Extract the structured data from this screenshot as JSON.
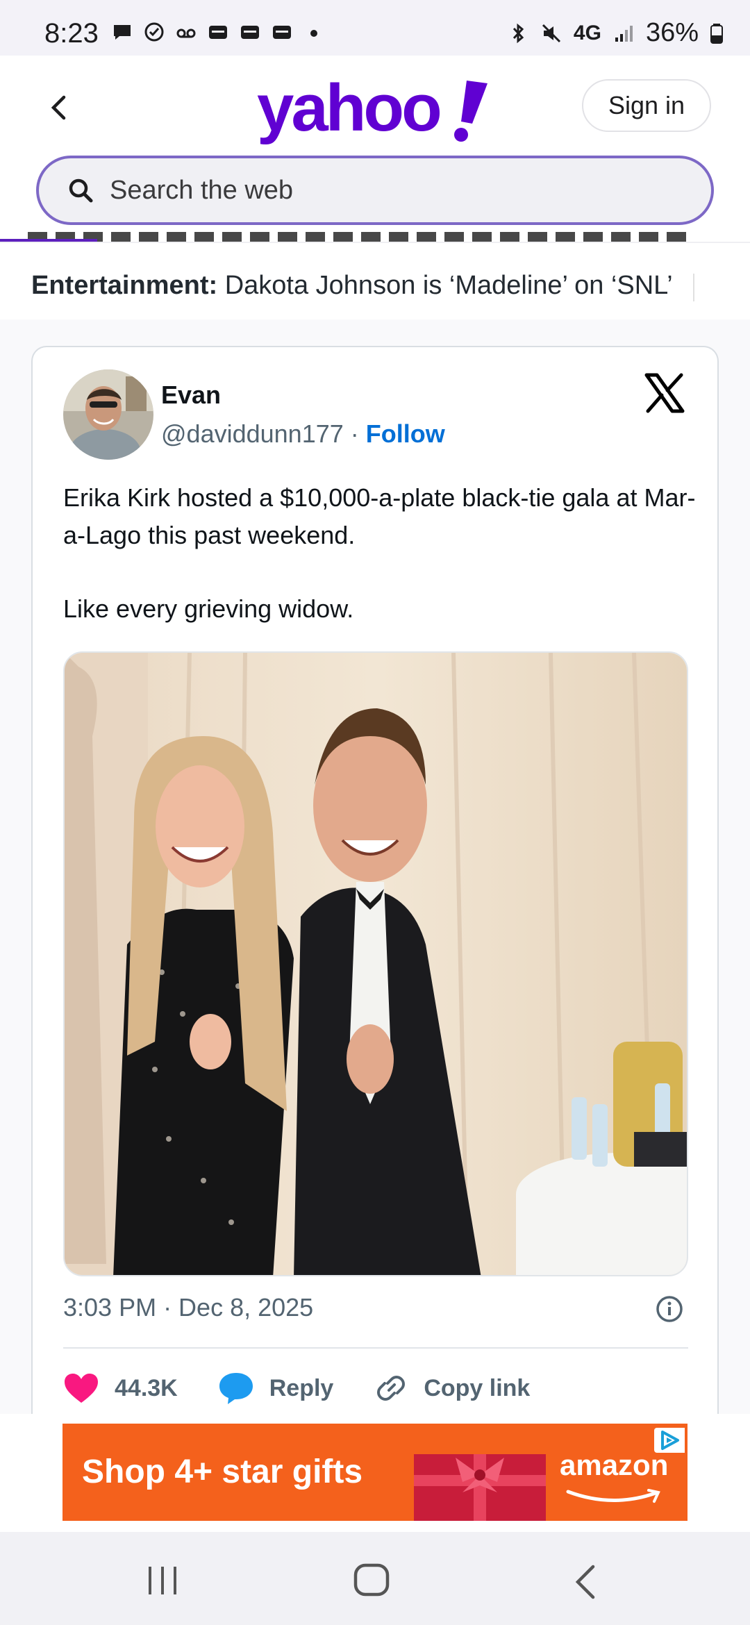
{
  "status_bar": {
    "time": "8:23",
    "network": "4G",
    "battery": "36%",
    "left_icons": [
      "message-icon",
      "check-circle-icon",
      "voicemail-icon",
      "inbox-icon",
      "inbox-icon",
      "inbox-icon",
      "dot-icon"
    ],
    "right_icons": [
      "bluetooth-icon",
      "mute-icon",
      "signal-icon",
      "battery-icon"
    ]
  },
  "header": {
    "logo_text": "yahoo!",
    "logo_color": "#6001d2",
    "sign_in_label": "Sign in",
    "search_placeholder": "Search the web",
    "search_border_color": "#7d68c6"
  },
  "ticker": {
    "label": "Entertainment:",
    "headline": "Dakota Johnson is ‘Madeline’ on ‘SNL’"
  },
  "tweet": {
    "author_name": "Evan",
    "author_handle": "@daviddunn177",
    "separator": "·",
    "follow_label": "Follow",
    "text_line1": "Erika Kirk hosted a $10,000-a-plate black-tie gala at Mar-a-Lago this past weekend.",
    "text_line2": "Like every grieving widow.",
    "timestamp": "3:03 PM · Dec 8, 2025",
    "likes": "44.3K",
    "reply_label": "Reply",
    "copy_link_label": "Copy link",
    "like_color": "#f91880",
    "reply_color": "#1d9bf0"
  },
  "ad": {
    "headline": "Shop 4+ star gifts",
    "brand": "amazon",
    "background_color": "#f4611c"
  }
}
